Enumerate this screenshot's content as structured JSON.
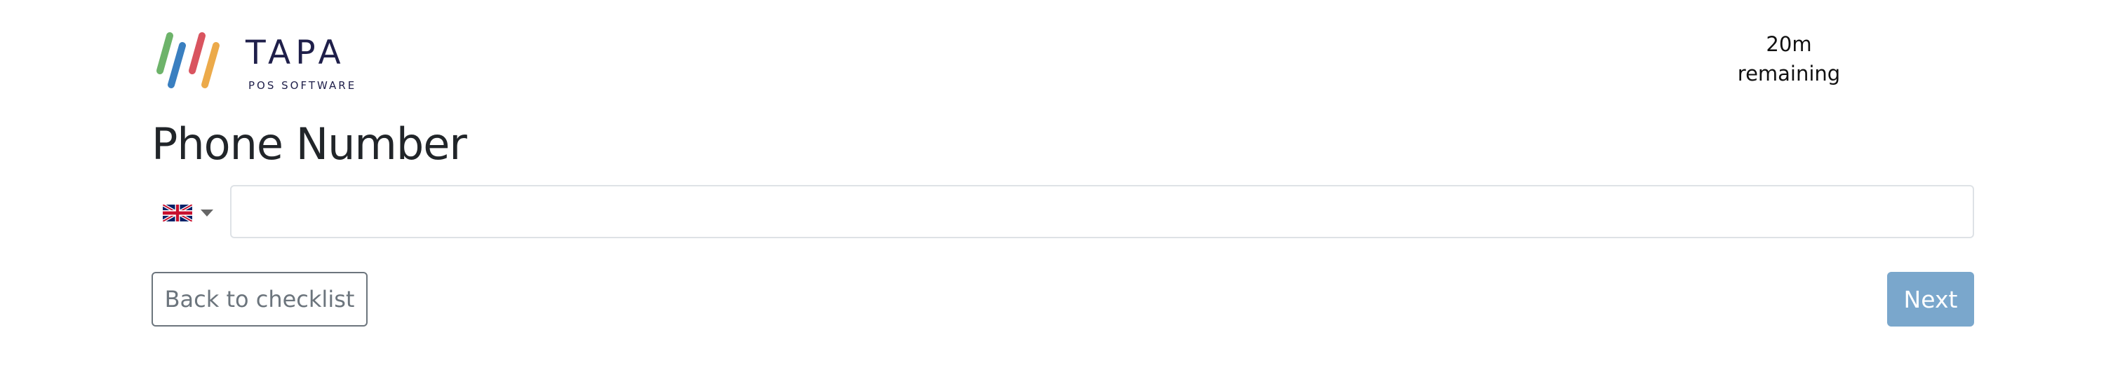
{
  "logo": {
    "name": "TAPA",
    "tagline": "POS SOFTWARE",
    "stripe_colors": [
      "#6db36a",
      "#3a7fc0",
      "#d9545f",
      "#ecaa4a"
    ]
  },
  "timer": {
    "value": "20m",
    "label": "remaining"
  },
  "page_title": "Phone Number",
  "phone": {
    "country_flag_icon": "uk-flag-icon",
    "value": "",
    "placeholder": ""
  },
  "actions": {
    "back_label": "Back to checklist",
    "next_label": "Next",
    "next_color": "#7aa7cc"
  }
}
